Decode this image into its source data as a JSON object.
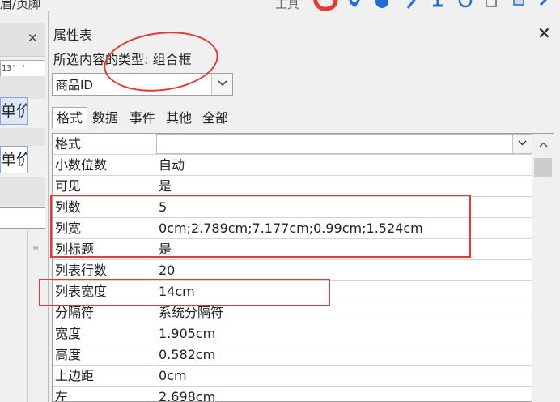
{
  "toolbar": {
    "left_text": "眉/页脚",
    "tools_label": "工具",
    "icons": [
      "red-logo-icon",
      "blue-glyph-icon",
      "blue-circle-icon",
      "pen-icon",
      "pin-icon",
      "clock-icon",
      "copy-icon",
      "paint-icon",
      "check-icon"
    ]
  },
  "left_panel": {
    "field_text": "13' '",
    "cell_text": "单价",
    "grip": "≡"
  },
  "property_sheet": {
    "title": "属性表",
    "close": "×",
    "selection_type": "所选内容的类型: 组合框",
    "selected_object": "商品ID",
    "tabs": [
      {
        "label": "格式",
        "active": true
      },
      {
        "label": "数据",
        "active": false
      },
      {
        "label": "事件",
        "active": false
      },
      {
        "label": "其他",
        "active": false
      },
      {
        "label": "全部",
        "active": false
      }
    ],
    "rows": [
      {
        "name": "格式",
        "value": ""
      },
      {
        "name": "小数位数",
        "value": "自动"
      },
      {
        "name": "可见",
        "value": "是"
      },
      {
        "name": "列数",
        "value": "5"
      },
      {
        "name": "列宽",
        "value": "0cm;2.789cm;7.177cm;0.99cm;1.524cm"
      },
      {
        "name": "列标题",
        "value": "是"
      },
      {
        "name": "列表行数",
        "value": "20"
      },
      {
        "name": "列表宽度",
        "value": "14cm"
      },
      {
        "name": "分隔符",
        "value": "系统分隔符"
      },
      {
        "name": "宽度",
        "value": "1.905cm"
      },
      {
        "name": "高度",
        "value": "0.582cm"
      },
      {
        "name": "上边距",
        "value": "0cm"
      },
      {
        "name": "左",
        "value": "2.698cm"
      }
    ]
  },
  "annotation_color": "#e53935"
}
